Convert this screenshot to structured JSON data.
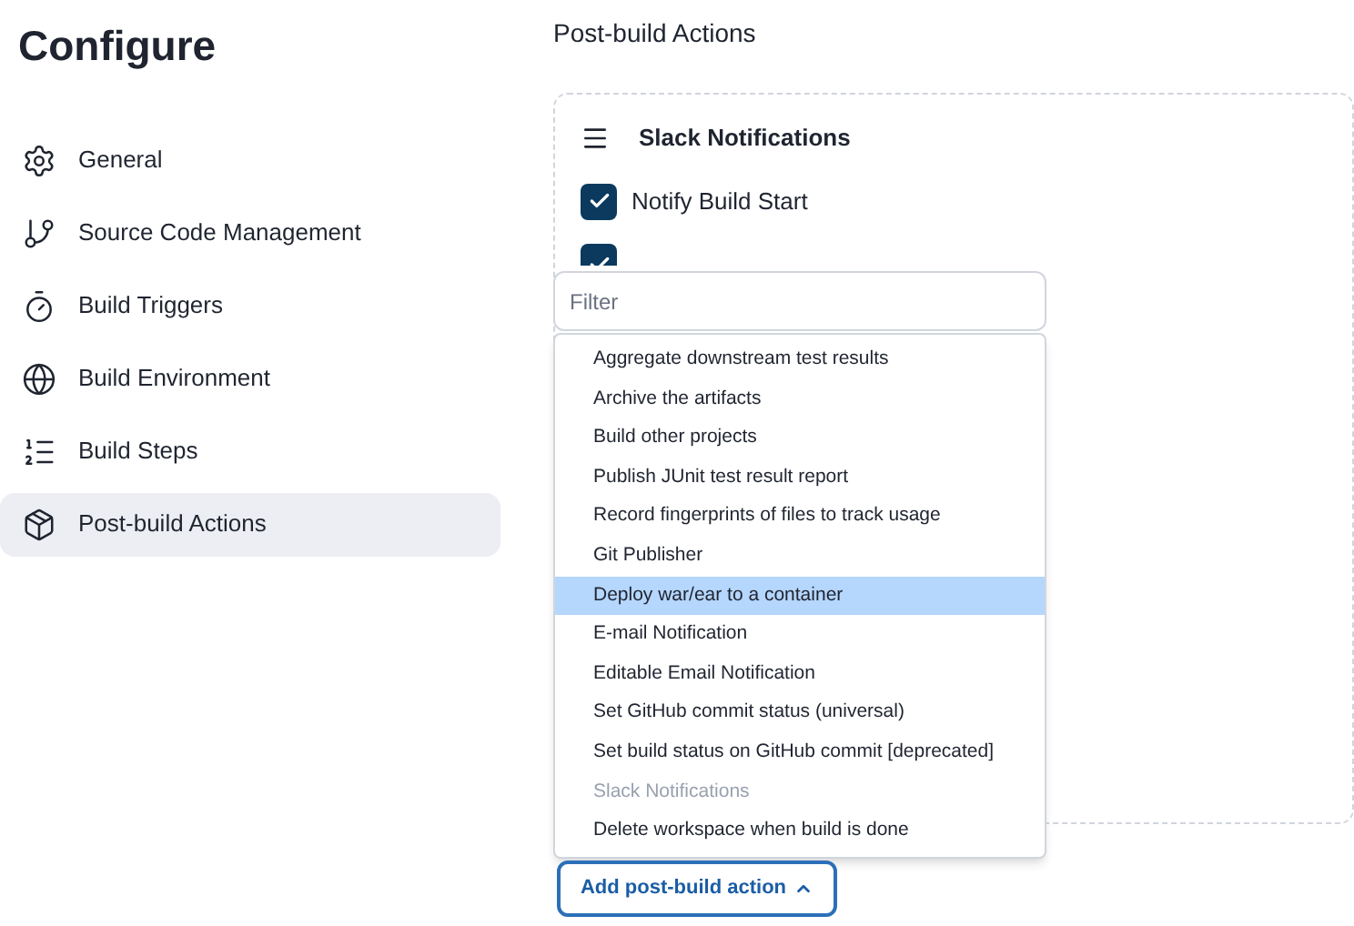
{
  "page_title": "Configure",
  "sidebar": {
    "items": [
      {
        "label": "General",
        "selected": false
      },
      {
        "label": "Source Code Management",
        "selected": false
      },
      {
        "label": "Build Triggers",
        "selected": false
      },
      {
        "label": "Build Environment",
        "selected": false
      },
      {
        "label": "Build Steps",
        "selected": false
      },
      {
        "label": "Post-build Actions",
        "selected": true
      }
    ]
  },
  "section_title": "Post-build Actions",
  "card": {
    "title": "Slack Notifications",
    "options": [
      {
        "label": "Notify Build Start",
        "checked": true
      }
    ],
    "hidden_checkbox": {
      "checked": true
    }
  },
  "filter": {
    "placeholder": "Filter"
  },
  "menu": {
    "items": [
      {
        "label": "Aggregate downstream test results",
        "selected": false,
        "disabled": false
      },
      {
        "label": "Archive the artifacts",
        "selected": false,
        "disabled": false
      },
      {
        "label": "Build other projects",
        "selected": false,
        "disabled": false
      },
      {
        "label": "Publish JUnit test result report",
        "selected": false,
        "disabled": false
      },
      {
        "label": "Record fingerprints of files to track usage",
        "selected": false,
        "disabled": false
      },
      {
        "label": "Git Publisher",
        "selected": false,
        "disabled": false
      },
      {
        "label": "Deploy war/ear to a container",
        "selected": true,
        "disabled": false
      },
      {
        "label": "E-mail Notification",
        "selected": false,
        "disabled": false
      },
      {
        "label": "Editable Email Notification",
        "selected": false,
        "disabled": false
      },
      {
        "label": "Set GitHub commit status (universal)",
        "selected": false,
        "disabled": false
      },
      {
        "label": "Set build status on GitHub commit [deprecated]",
        "selected": false,
        "disabled": false
      },
      {
        "label": "Slack Notifications",
        "selected": false,
        "disabled": true
      },
      {
        "label": "Delete workspace when build is done",
        "selected": false,
        "disabled": false
      }
    ]
  },
  "add_button": {
    "label": "Add post-build action",
    "expanded": true
  }
}
